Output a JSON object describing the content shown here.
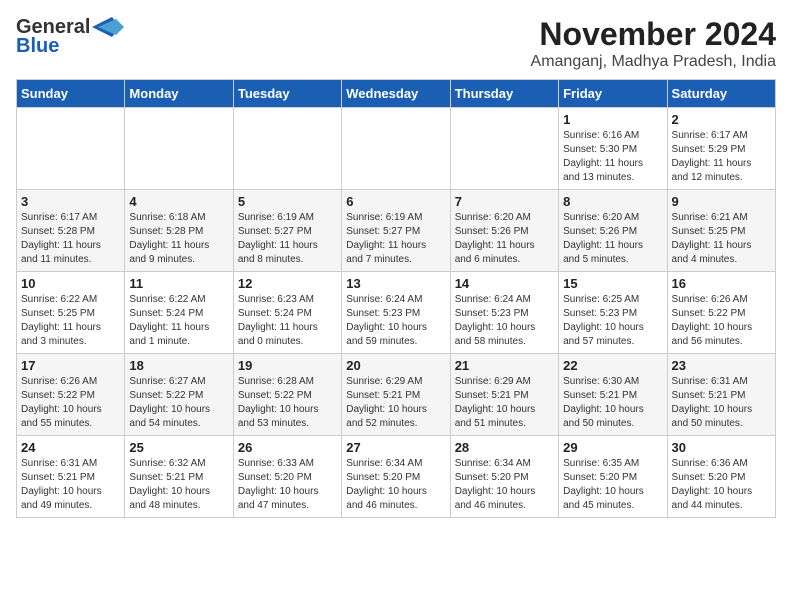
{
  "logo": {
    "line1": "General",
    "line2": "Blue"
  },
  "title": "November 2024",
  "subtitle": "Amanganj, Madhya Pradesh, India",
  "header": {
    "days": [
      "Sunday",
      "Monday",
      "Tuesday",
      "Wednesday",
      "Thursday",
      "Friday",
      "Saturday"
    ]
  },
  "weeks": [
    {
      "cells": [
        {
          "day": "",
          "info": ""
        },
        {
          "day": "",
          "info": ""
        },
        {
          "day": "",
          "info": ""
        },
        {
          "day": "",
          "info": ""
        },
        {
          "day": "",
          "info": ""
        },
        {
          "day": "1",
          "info": "Sunrise: 6:16 AM\nSunset: 5:30 PM\nDaylight: 11 hours\nand 13 minutes."
        },
        {
          "day": "2",
          "info": "Sunrise: 6:17 AM\nSunset: 5:29 PM\nDaylight: 11 hours\nand 12 minutes."
        }
      ]
    },
    {
      "cells": [
        {
          "day": "3",
          "info": "Sunrise: 6:17 AM\nSunset: 5:28 PM\nDaylight: 11 hours\nand 11 minutes."
        },
        {
          "day": "4",
          "info": "Sunrise: 6:18 AM\nSunset: 5:28 PM\nDaylight: 11 hours\nand 9 minutes."
        },
        {
          "day": "5",
          "info": "Sunrise: 6:19 AM\nSunset: 5:27 PM\nDaylight: 11 hours\nand 8 minutes."
        },
        {
          "day": "6",
          "info": "Sunrise: 6:19 AM\nSunset: 5:27 PM\nDaylight: 11 hours\nand 7 minutes."
        },
        {
          "day": "7",
          "info": "Sunrise: 6:20 AM\nSunset: 5:26 PM\nDaylight: 11 hours\nand 6 minutes."
        },
        {
          "day": "8",
          "info": "Sunrise: 6:20 AM\nSunset: 5:26 PM\nDaylight: 11 hours\nand 5 minutes."
        },
        {
          "day": "9",
          "info": "Sunrise: 6:21 AM\nSunset: 5:25 PM\nDaylight: 11 hours\nand 4 minutes."
        }
      ]
    },
    {
      "cells": [
        {
          "day": "10",
          "info": "Sunrise: 6:22 AM\nSunset: 5:25 PM\nDaylight: 11 hours\nand 3 minutes."
        },
        {
          "day": "11",
          "info": "Sunrise: 6:22 AM\nSunset: 5:24 PM\nDaylight: 11 hours\nand 1 minute."
        },
        {
          "day": "12",
          "info": "Sunrise: 6:23 AM\nSunset: 5:24 PM\nDaylight: 11 hours\nand 0 minutes."
        },
        {
          "day": "13",
          "info": "Sunrise: 6:24 AM\nSunset: 5:23 PM\nDaylight: 10 hours\nand 59 minutes."
        },
        {
          "day": "14",
          "info": "Sunrise: 6:24 AM\nSunset: 5:23 PM\nDaylight: 10 hours\nand 58 minutes."
        },
        {
          "day": "15",
          "info": "Sunrise: 6:25 AM\nSunset: 5:23 PM\nDaylight: 10 hours\nand 57 minutes."
        },
        {
          "day": "16",
          "info": "Sunrise: 6:26 AM\nSunset: 5:22 PM\nDaylight: 10 hours\nand 56 minutes."
        }
      ]
    },
    {
      "cells": [
        {
          "day": "17",
          "info": "Sunrise: 6:26 AM\nSunset: 5:22 PM\nDaylight: 10 hours\nand 55 minutes."
        },
        {
          "day": "18",
          "info": "Sunrise: 6:27 AM\nSunset: 5:22 PM\nDaylight: 10 hours\nand 54 minutes."
        },
        {
          "day": "19",
          "info": "Sunrise: 6:28 AM\nSunset: 5:22 PM\nDaylight: 10 hours\nand 53 minutes."
        },
        {
          "day": "20",
          "info": "Sunrise: 6:29 AM\nSunset: 5:21 PM\nDaylight: 10 hours\nand 52 minutes."
        },
        {
          "day": "21",
          "info": "Sunrise: 6:29 AM\nSunset: 5:21 PM\nDaylight: 10 hours\nand 51 minutes."
        },
        {
          "day": "22",
          "info": "Sunrise: 6:30 AM\nSunset: 5:21 PM\nDaylight: 10 hours\nand 50 minutes."
        },
        {
          "day": "23",
          "info": "Sunrise: 6:31 AM\nSunset: 5:21 PM\nDaylight: 10 hours\nand 50 minutes."
        }
      ]
    },
    {
      "cells": [
        {
          "day": "24",
          "info": "Sunrise: 6:31 AM\nSunset: 5:21 PM\nDaylight: 10 hours\nand 49 minutes."
        },
        {
          "day": "25",
          "info": "Sunrise: 6:32 AM\nSunset: 5:21 PM\nDaylight: 10 hours\nand 48 minutes."
        },
        {
          "day": "26",
          "info": "Sunrise: 6:33 AM\nSunset: 5:20 PM\nDaylight: 10 hours\nand 47 minutes."
        },
        {
          "day": "27",
          "info": "Sunrise: 6:34 AM\nSunset: 5:20 PM\nDaylight: 10 hours\nand 46 minutes."
        },
        {
          "day": "28",
          "info": "Sunrise: 6:34 AM\nSunset: 5:20 PM\nDaylight: 10 hours\nand 46 minutes."
        },
        {
          "day": "29",
          "info": "Sunrise: 6:35 AM\nSunset: 5:20 PM\nDaylight: 10 hours\nand 45 minutes."
        },
        {
          "day": "30",
          "info": "Sunrise: 6:36 AM\nSunset: 5:20 PM\nDaylight: 10 hours\nand 44 minutes."
        }
      ]
    }
  ]
}
